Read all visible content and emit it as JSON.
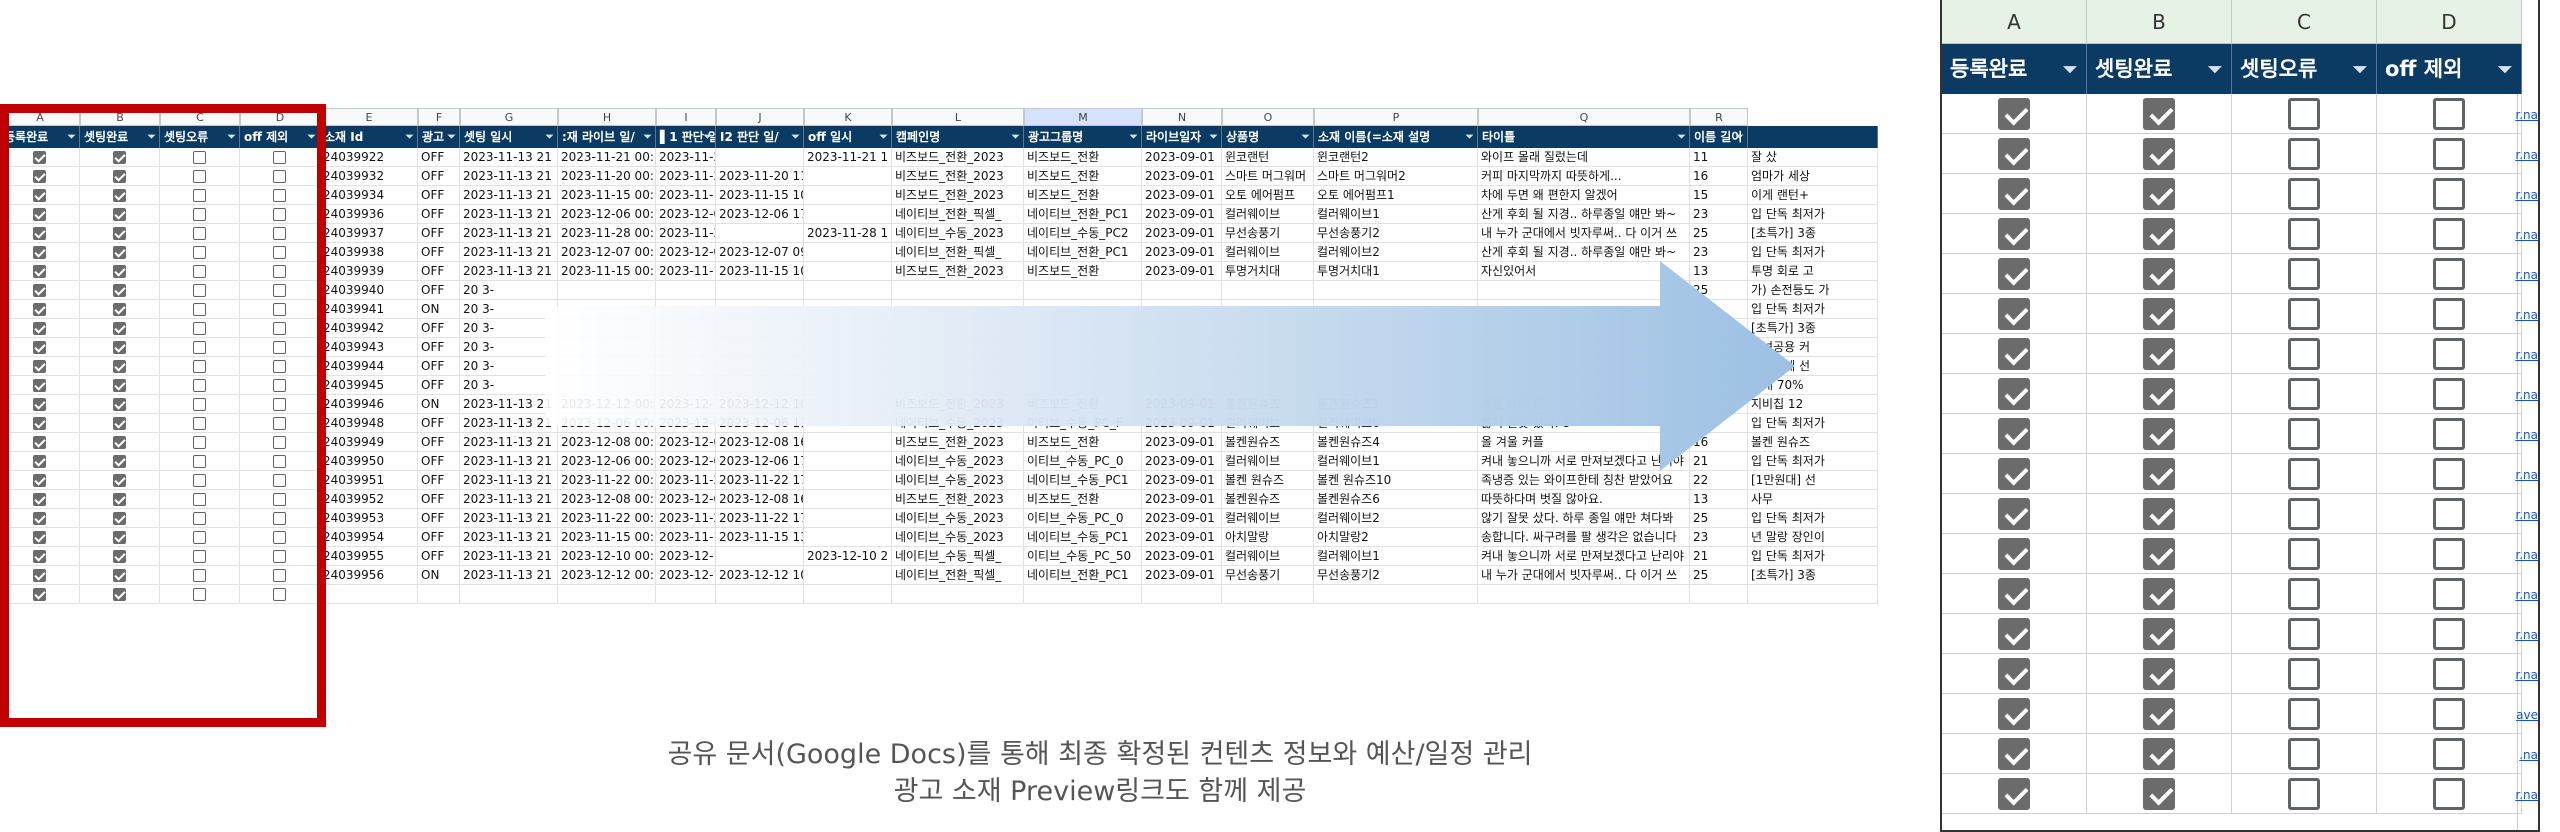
{
  "sheet": {
    "columns": [
      "A",
      "B",
      "C",
      "D",
      "E",
      "F",
      "G",
      "H",
      "I",
      "J",
      "K",
      "L",
      "M",
      "N",
      "O",
      "P",
      "Q",
      "R"
    ],
    "headers": [
      "등록완료",
      "셋팅완료",
      "셋팅오류",
      "off 제외",
      "소재 Id",
      "광고",
      "셋팅 일시",
      ":재 라이브 일/",
      "▌1 판단 일시",
      "I2 판단 일/",
      "off 일시",
      "캠페인명",
      "광고그룹명",
      "라이브일자",
      "상품명",
      "소재 이름(=소재 설명",
      "타이틀",
      "이름 길이",
      ""
    ],
    "rows": [
      {
        "checks": [
          true,
          true,
          false,
          false
        ],
        "cells": [
          "24039922",
          "OFF",
          "2023-11-13 21",
          "2023-11-21 00:",
          "2023-11-21 13:00:17",
          "",
          "2023-11-21 1",
          "비즈보드_전환_2023",
          "비즈보드_전환",
          "2023-09-01",
          "윈코랜턴",
          "윈코랜턴2",
          "와이프 몰래 질렀는데",
          "11",
          "잘 샀"
        ]
      },
      {
        "checks": [
          true,
          true,
          false,
          false
        ],
        "cells": [
          "24039932",
          "OFF",
          "2023-11-13 21",
          "2023-11-20 00:",
          "2023-11-20 11",
          "2023-11-20 11:40:29",
          "",
          "비즈보드_전환_2023",
          "비즈보드_전환",
          "2023-09-01",
          "스마트 머그워머",
          "스마트 머그워머2",
          "커피 마지막까지 따뜻하게...",
          "16",
          "엄마가 세상"
        ]
      },
      {
        "checks": [
          true,
          true,
          false,
          false
        ],
        "cells": [
          "24039934",
          "OFF",
          "2023-11-13 21",
          "2023-11-15 00:",
          "2023-11-15 1(",
          "2023-11-15 10:51:38",
          "",
          "비즈보드_전환_2023",
          "비즈보드_전환",
          "2023-09-01",
          "오토 에어펌프",
          "오토 에어펌프1",
          "차에 두면 왜 편한지 알겠어",
          "15",
          "이게 랜턴+"
        ]
      },
      {
        "checks": [
          true,
          true,
          false,
          false
        ],
        "cells": [
          "24039936",
          "OFF",
          "2023-11-13 21",
          "2023-12-06 00:",
          "2023-12-06 1",
          "2023-12-06 17:40:10",
          "",
          "네이티브_전환_픽셀_",
          "네이티브_전환_PC1",
          "2023-09-01",
          "컬러웨이브",
          "컬러웨이브1",
          "산게 후회 될 지경.. 하루종일 얘만 봐~",
          "23",
          "입 단독 최저가"
        ]
      },
      {
        "checks": [
          true,
          true,
          false,
          false
        ],
        "cells": [
          "24039937",
          "OFF",
          "2023-11-13 21",
          "2023-11-28 00:",
          "2023-11-28 11:40:15",
          "",
          "2023-11-28 1",
          "네이티브_수동_2023",
          "네이티브_수동_PC2",
          "2023-09-01",
          "무선송풍기",
          "무선송풍기2",
          "내 누가 군대에서 빗자루써.. 다 이거 쓰",
          "25",
          "[초특가] 3종"
        ]
      },
      {
        "checks": [
          true,
          true,
          false,
          false
        ],
        "cells": [
          "24039938",
          "OFF",
          "2023-11-13 21",
          "2023-12-07 00:",
          "2023-12-07 09:",
          "2023-12-07 09:20:09",
          "",
          "네이티브_전환_픽셀_",
          "네이티브_전환_PC1",
          "2023-09-01",
          "컬러웨이브",
          "컬러웨이브2",
          "산게 후회 될 지경.. 하루종일 얘만 봐~",
          "23",
          "입 단독 최저가"
        ]
      },
      {
        "checks": [
          true,
          true,
          false,
          false
        ],
        "cells": [
          "24039939",
          "OFF",
          "2023-11-13 21",
          "2023-11-15 00:",
          "2023-11-15 1(",
          "2023-11-15 10:51:38",
          "",
          "비즈보드_전환_2023",
          "비즈보드_전환",
          "2023-09-01",
          "투명거치대",
          "투명거치대1",
          "자신있어서",
          "13",
          "투명 회로 고"
        ]
      },
      {
        "checks": [
          true,
          true,
          false,
          false
        ],
        "cells": [
          "24039940",
          "OFF",
          "20 3-",
          "",
          "",
          "",
          "",
          "",
          "",
          "",
          "",
          "",
          "",
          "25",
          "가) 손전등도 가"
        ]
      },
      {
        "checks": [
          true,
          true,
          false,
          false
        ],
        "cells": [
          "24039941",
          "ON",
          "20 3-",
          "",
          "",
          "",
          "",
          "",
          "",
          "",
          "",
          "",
          "",
          "25",
          "입 단독 최저가"
        ]
      },
      {
        "checks": [
          true,
          true,
          false,
          false
        ],
        "cells": [
          "24039942",
          "OFF",
          "20 3-",
          "",
          "",
          "",
          "",
          "",
          "",
          "",
          "",
          "",
          "",
          "24",
          "[초특가] 3종"
        ]
      },
      {
        "checks": [
          true,
          true,
          false,
          false
        ],
        "cells": [
          "24039943",
          "OFF",
          "20 3-",
          "",
          "",
          "",
          "",
          "",
          "",
          "",
          "",
          "",
          "",
          "17",
          "남녀공용 커"
        ]
      },
      {
        "checks": [
          true,
          true,
          false,
          false
        ],
        "cells": [
          "24039944",
          "OFF",
          "20 3-",
          "",
          "",
          "",
          "",
          "",
          "",
          "",
          "",
          "",
          "",
          "15",
          "어진한데 선"
        ]
      },
      {
        "checks": [
          true,
          true,
          false,
          false
        ],
        "cells": [
          "24039945",
          "OFF",
          "20 3-",
          "",
          "",
          "",
          "",
          "",
          "",
          "",
          "",
          "",
          "",
          "17",
          "최대 70%"
        ]
      },
      {
        "checks": [
          true,
          true,
          false,
          false
        ],
        "cells": [
          "24039946",
          "ON",
          "2023-11-13 21",
          "2023-12-12 00:",
          "2023-12-12 1(",
          "2023-12-12 10:20:12",
          "",
          "비즈보드_전환_2023",
          "비즈보드_전환",
          "2023-09-01",
          "볼켄원슈즈",
          "볼켄원슈즈1",
          "겨울 대비 필",
          "15",
          "지비칩 12"
        ]
      },
      {
        "checks": [
          true,
          true,
          false,
          false
        ],
        "cells": [
          "24039948",
          "OFF",
          "2023-11-13 21",
          "2023-12-06 00:",
          "2023-12-06 1",
          "2023-12-06 11:00:15",
          "",
          "네이티브_수동_2023",
          "이티브_수동_PC_F",
          "2023-09-01",
          "컬러웨이브",
          "컬러웨이브6",
          "않기 잘못 샀다. 8",
          "25",
          "입 단독 최저가"
        ]
      },
      {
        "checks": [
          true,
          true,
          false,
          false
        ],
        "cells": [
          "24039949",
          "OFF",
          "2023-11-13 21",
          "2023-12-08 00:",
          "2023-12-08 1(",
          "2023-12-08 16:00:17",
          "",
          "비즈보드_전환_2023",
          "비즈보드_전환",
          "2023-09-01",
          "볼켄원슈즈",
          "볼켄원슈즈4",
          "올 겨울 커플",
          "16",
          "볼켄 원슈즈"
        ]
      },
      {
        "checks": [
          true,
          true,
          false,
          false
        ],
        "cells": [
          "24039950",
          "OFF",
          "2023-11-13 21",
          "2023-12-06 00:",
          "2023-12-06 1",
          "2023-12-06 17:00:17",
          "",
          "네이티브_수동_2023",
          "이티브_수동_PC_0",
          "2023-09-01",
          "컬러웨이브",
          "컬러웨이브1",
          "켜내 놓으니까 서로 만져보겠다고 난리야",
          "21",
          "입 단독 최저가"
        ]
      },
      {
        "checks": [
          true,
          true,
          false,
          false
        ],
        "cells": [
          "24039951",
          "OFF",
          "2023-11-13 21",
          "2023-11-22 00:",
          "2023-11-22 1",
          "2023-11-22 17:00:26",
          "",
          "네이티브_수동_2023",
          "네이티브_수동_PC1",
          "2023-09-01",
          "볼켄 원슈즈",
          "볼켄 원슈즈10",
          "족냉증 있는 와이프한테 칭찬 받았어요",
          "22",
          "[1만원대] 선"
        ]
      },
      {
        "checks": [
          true,
          true,
          false,
          false
        ],
        "cells": [
          "24039952",
          "OFF",
          "2023-11-13 21",
          "2023-12-08 00:",
          "2023-12-08 1(",
          "2023-12-08 16:00:18",
          "",
          "비즈보드_전환_2023",
          "비즈보드_전환",
          "2023-09-01",
          "볼켄원슈즈",
          "볼켄원슈즈6",
          "따뜻하다며 벗질 않아요.",
          "13",
          "사무"
        ]
      },
      {
        "checks": [
          true,
          true,
          false,
          false
        ],
        "cells": [
          "24039953",
          "OFF",
          "2023-11-13 21",
          "2023-11-22 00:",
          "2023-11-22 1",
          "2023-11-22 17:00:28",
          "",
          "네이티브_수동_2023",
          "이티브_수동_PC_0",
          "2023-09-01",
          "컬러웨이브",
          "컬러웨이브2",
          "않기 잘못 샀다. 하루 종일 얘만 쳐다봐",
          "25",
          "입 단독 최저가"
        ]
      },
      {
        "checks": [
          true,
          true,
          false,
          false
        ],
        "cells": [
          "24039954",
          "OFF",
          "2023-11-13 21",
          "2023-11-15 00:",
          "2023-11-15 1:",
          "2023-11-15 13:20:54",
          "",
          "네이티브_수동_2023",
          "네이티브_수동_PC1",
          "2023-09-01",
          "아치말랑",
          "아치말랑2",
          "송합니다. 싸구려를 팔 생각은 없습니다",
          "23",
          "년 말랑 장인이"
        ]
      },
      {
        "checks": [
          true,
          true,
          false,
          false
        ],
        "cells": [
          "24039955",
          "OFF",
          "2023-11-13 21",
          "2023-12-10 00:",
          "2023-12-10 20:40:21",
          "",
          "2023-12-10 2",
          "네이티브_수동_픽셀_",
          "이티브_수동_PC_50",
          "2023-09-01",
          "컬러웨이브",
          "컬러웨이브1",
          "켜내 놓으니까 서로 만져보겠다고 난리야",
          "21",
          "입 단독 최저가"
        ]
      },
      {
        "checks": [
          true,
          true,
          false,
          false
        ],
        "cells": [
          "24039956",
          "ON",
          "2023-11-13 21",
          "2023-12-12 00:",
          "2023-12-12 1(",
          "2023-12-12 10:20:15",
          "",
          "네이티브_전환_픽셀_",
          "네이티브_전환_PC1",
          "2023-09-01",
          "무선송풍기",
          "무선송풍기2",
          "내 누가 군대에서 빗자루써.. 다 이거 쓰",
          "25",
          "[초특가] 3종"
        ]
      },
      {
        "checks": [
          true,
          true,
          false,
          false
        ],
        "cells": [
          "",
          "",
          "",
          "",
          "",
          "",
          "",
          "",
          "",
          "",
          "",
          "",
          "",
          "",
          ""
        ]
      }
    ]
  },
  "caption": {
    "line1": "공유 문서(Google Docs)를 통해 최종 확정된 컨텐츠 정보와 예산/일정 관리",
    "line2": "광고 소재 Preview링크도 함께 제공"
  },
  "zoom": {
    "columns": [
      "A",
      "B",
      "C",
      "D"
    ],
    "headers": [
      "등록완료",
      "셋팅완료",
      "셋팅오류",
      "off 제외"
    ],
    "checks": [
      true,
      true,
      false,
      false
    ],
    "row_count": 18,
    "side_links": [
      "r.na",
      "r.na",
      "r.na",
      "r.na",
      "r.na",
      "r.na",
      "r.na",
      "r.na",
      "r.na",
      "r.na",
      "r.na",
      "r.na",
      "r.na",
      "r.na",
      "r.na",
      "ave",
      ".na",
      "r.na"
    ]
  },
  "colors": {
    "header_bg": "#0b3a63",
    "highlight": "#c00000",
    "arrow": "#9cc0e3"
  },
  "filter_icon": "filter-icon"
}
